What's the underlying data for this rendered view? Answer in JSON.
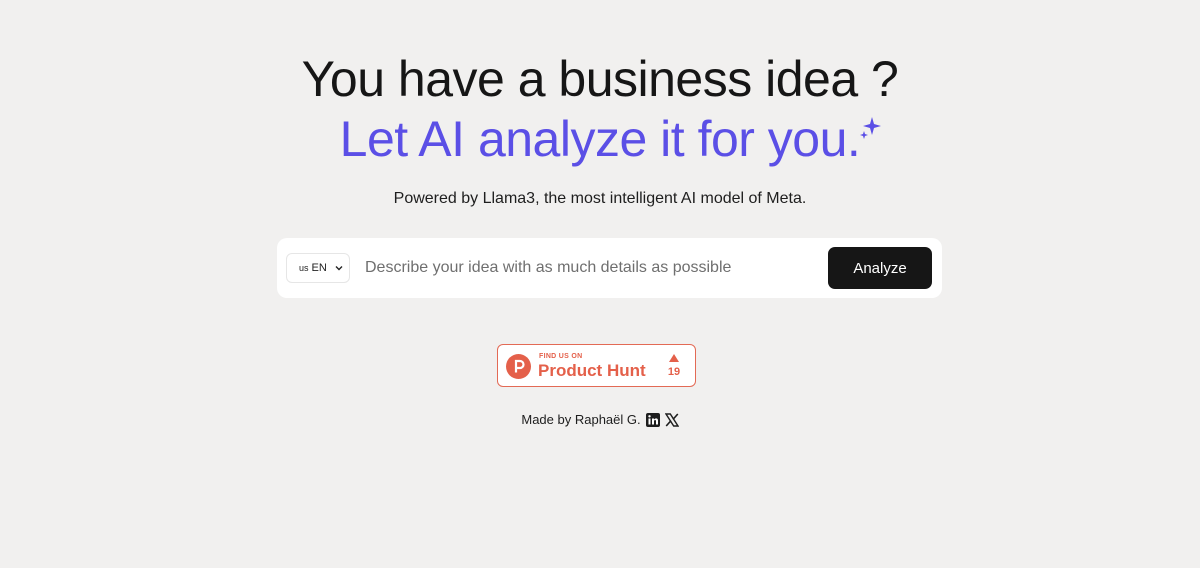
{
  "hero": {
    "line1": "You have a business idea ?",
    "line2": "Let AI analyze it for you.",
    "subtitle": "Powered by Llama3, the most intelligent AI model of Meta.",
    "accent_color": "#5b4fe6"
  },
  "search": {
    "language": {
      "flag": "us",
      "selected": "EN"
    },
    "placeholder": "Describe your idea with as much details as possible",
    "value": "",
    "button_label": "Analyze"
  },
  "product_hunt": {
    "kicker": "FIND US ON",
    "name": "Product Hunt",
    "votes": "19",
    "color": "#e4604a"
  },
  "footer": {
    "made_by": "Made by Raphaël G.",
    "icons": [
      "linkedin-icon",
      "x-icon"
    ]
  }
}
